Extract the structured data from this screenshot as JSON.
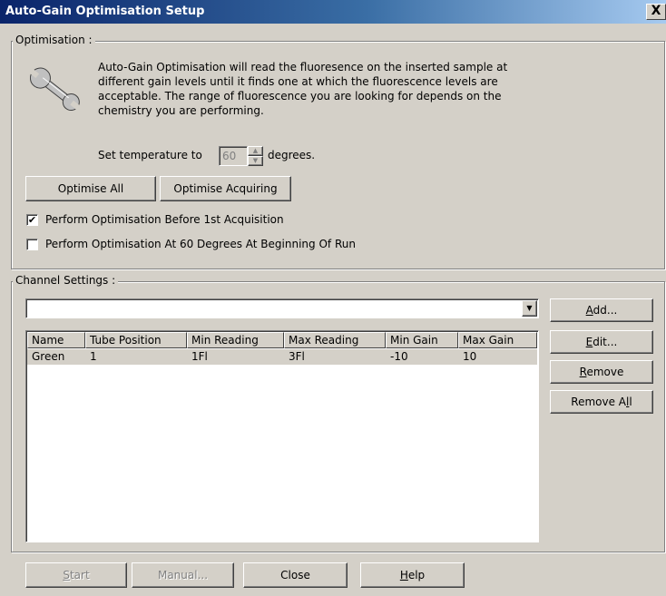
{
  "window": {
    "title": "Auto-Gain Optimisation Setup",
    "close_glyph": "X"
  },
  "optimisation": {
    "legend": "Optimisation :",
    "icon": "wrench-icon",
    "description": [
      "Auto-Gain Optimisation will read the fluoresence on the inserted sample at",
      "different gain levels until it finds one at which the fluorescence levels are",
      "acceptable. The range of fluorescence you are looking for depends on the",
      "chemistry you are performing."
    ],
    "temperature_prefix": "Set temperature to",
    "temperature_value": "60",
    "temperature_suffix": "degrees.",
    "optimise_all_label": "Optimise All",
    "optimise_acquiring_label": "Optimise Acquiring",
    "checkbox_before_acquisition": {
      "label": "Perform Optimisation Before 1st Acquisition",
      "checked": true
    },
    "checkbox_at_60": {
      "label": "Perform Optimisation At 60 Degrees At Beginning Of Run",
      "checked": false
    }
  },
  "channel_settings": {
    "legend": "Channel Settings :",
    "dropdown_value": "",
    "columns": [
      "Name",
      "Tube Position",
      "Min Reading",
      "Max Reading",
      "Min Gain",
      "Max Gain"
    ],
    "rows": [
      [
        "Green",
        "1",
        "1Fl",
        "3Fl",
        "-10",
        "10"
      ]
    ],
    "buttons": {
      "add": {
        "before": "",
        "key": "A",
        "after": "dd..."
      },
      "edit": {
        "before": "",
        "key": "E",
        "after": "dit..."
      },
      "remove": {
        "before": "",
        "key": "R",
        "after": "emove"
      },
      "remove_all": {
        "before": "Remove A",
        "key": "l",
        "after": "l"
      }
    }
  },
  "footer": {
    "start": {
      "before": "",
      "key": "S",
      "after": "tart",
      "enabled": false
    },
    "manual": {
      "label": "Manual...",
      "enabled": false
    },
    "close": {
      "label": "Close",
      "enabled": true
    },
    "help": {
      "before": "",
      "key": "H",
      "after": "elp",
      "enabled": true
    }
  },
  "colors": {
    "face": "#d4d0c8",
    "title_start": "#0a246a",
    "title_end": "#a6caf0",
    "selected_row": "#d4d0c8"
  }
}
